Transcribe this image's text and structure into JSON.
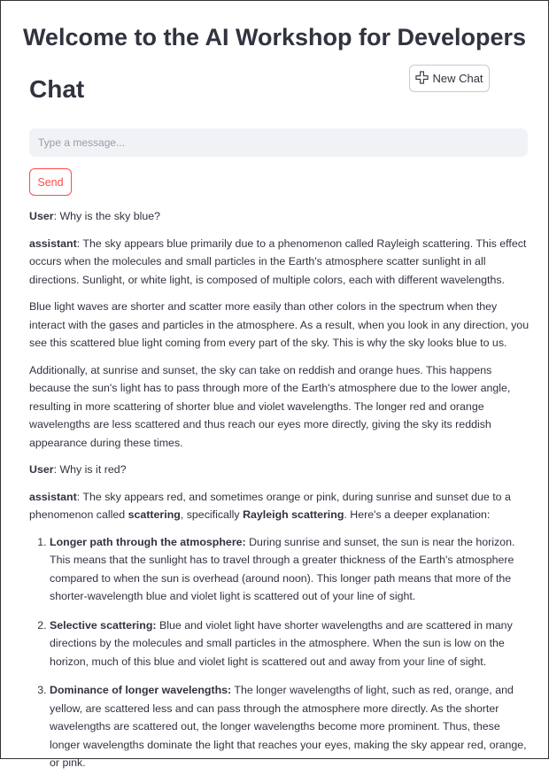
{
  "page_title": "Welcome to the AI Workshop for Developers",
  "chat_heading": "Chat",
  "new_chat_label": "New Chat",
  "input": {
    "placeholder": "Type a message...",
    "value": ""
  },
  "send_label": "Send",
  "messages": [
    {
      "role": "User",
      "text": ": Why is the sky blue?"
    },
    {
      "role": "assistant",
      "paragraphs": [
        ": The sky appears blue primarily due to a phenomenon called Rayleigh scattering. This effect occurs when the molecules and small particles in the Earth's atmosphere scatter sunlight in all directions. Sunlight, or white light, is composed of multiple colors, each with different wavelengths.",
        "Blue light waves are shorter and scatter more easily than other colors in the spectrum when they interact with the gases and particles in the atmosphere. As a result, when you look in any direction, you see this scattered blue light coming from every part of the sky. This is why the sky looks blue to us.",
        "Additionally, at sunrise and sunset, the sky can take on reddish and orange hues. This happens because the sun's light has to pass through more of the Earth's atmosphere due to the lower angle, resulting in more scattering of shorter blue and violet wavelengths. The longer red and orange wavelengths are less scattered and thus reach our eyes more directly, giving the sky its reddish appearance during these times."
      ]
    },
    {
      "role": "User",
      "text": ": Why is it red?"
    },
    {
      "role": "assistant",
      "intro_a": ": The sky appears red, and sometimes orange or pink, during sunrise and sunset due to a phenomenon called ",
      "intro_b1": "scattering",
      "intro_c": ", specifically ",
      "intro_b2": "Rayleigh scattering",
      "intro_d": ". Here's a deeper explanation:",
      "list": [
        {
          "title": "Longer path through the atmosphere:",
          "text": " During sunrise and sunset, the sun is near the horizon. This means that the sunlight has to travel through a greater thickness of the Earth's atmosphere compared to when the sun is overhead (around noon). This longer path means that more of the shorter-wavelength blue and violet light is scattered out of your line of sight."
        },
        {
          "title": "Selective scattering:",
          "text": " Blue and violet light have shorter wavelengths and are scattered in many directions by the molecules and small particles in the atmosphere. When the sun is low on the horizon, much of this blue and violet light is scattered out and away from your line of sight."
        },
        {
          "title": "Dominance of longer wavelengths:",
          "text": " The longer wavelengths of light, such as red, orange, and yellow, are scattered less and can pass through the atmosphere more directly. As the shorter wavelengths are scattered out, the longer wavelengths become more prominent. Thus, these longer wavelengths dominate the light that reaches your eyes, making the sky appear red, orange, or pink."
        }
      ]
    }
  ],
  "colors": {
    "accent": "#ff4b4b",
    "text": "#31333f",
    "input_bg": "#f0f2f6"
  }
}
